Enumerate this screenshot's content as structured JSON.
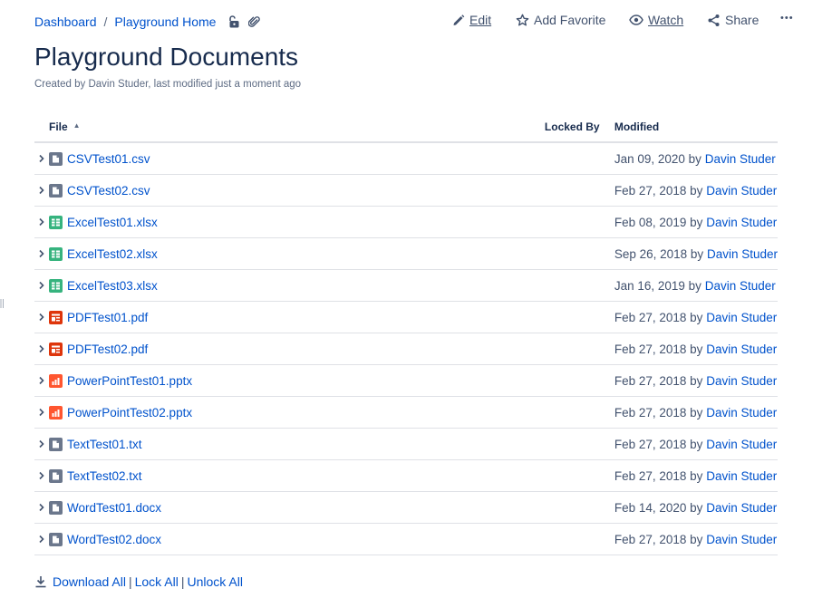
{
  "breadcrumb": {
    "items": [
      {
        "label": "Dashboard"
      },
      {
        "label": "Playground Home"
      }
    ],
    "separator": "/"
  },
  "actions": {
    "edit": "Edit",
    "add_favorite": "Add Favorite",
    "watch": "Watch",
    "share": "Share",
    "more": "•••"
  },
  "page": {
    "title": "Playground Documents",
    "byline_prefix": "Created by Davin Studer, last modified ",
    "byline_time": "just a moment ago"
  },
  "table": {
    "headers": {
      "file": "File",
      "locked_by": "Locked By",
      "modified": "Modified"
    },
    "rows": [
      {
        "name": "CSVTest01.csv",
        "type": "generic",
        "date": "Jan 09, 2020",
        "by": "by",
        "user": "Davin Studer"
      },
      {
        "name": "CSVTest02.csv",
        "type": "generic",
        "date": "Feb 27, 2018",
        "by": "by",
        "user": "Davin Studer"
      },
      {
        "name": "ExcelTest01.xlsx",
        "type": "excel",
        "date": "Feb 08, 2019",
        "by": "by",
        "user": "Davin Studer"
      },
      {
        "name": "ExcelTest02.xlsx",
        "type": "excel",
        "date": "Sep 26, 2018",
        "by": "by",
        "user": "Davin Studer"
      },
      {
        "name": "ExcelTest03.xlsx",
        "type": "excel",
        "date": "Jan 16, 2019",
        "by": "by",
        "user": "Davin Studer"
      },
      {
        "name": "PDFTest01.pdf",
        "type": "pdf",
        "date": "Feb 27, 2018",
        "by": "by",
        "user": "Davin Studer"
      },
      {
        "name": "PDFTest02.pdf",
        "type": "pdf",
        "date": "Feb 27, 2018",
        "by": "by",
        "user": "Davin Studer"
      },
      {
        "name": "PowerPointTest01.pptx",
        "type": "ppt",
        "date": "Feb 27, 2018",
        "by": "by",
        "user": "Davin Studer"
      },
      {
        "name": "PowerPointTest02.pptx",
        "type": "ppt",
        "date": "Feb 27, 2018",
        "by": "by",
        "user": "Davin Studer"
      },
      {
        "name": "TextTest01.txt",
        "type": "generic",
        "date": "Feb 27, 2018",
        "by": "by",
        "user": "Davin Studer"
      },
      {
        "name": "TextTest02.txt",
        "type": "generic",
        "date": "Feb 27, 2018",
        "by": "by",
        "user": "Davin Studer"
      },
      {
        "name": "WordTest01.docx",
        "type": "generic",
        "date": "Feb 14, 2020",
        "by": "by",
        "user": "Davin Studer"
      },
      {
        "name": "WordTest02.docx",
        "type": "generic",
        "date": "Feb 27, 2018",
        "by": "by",
        "user": "Davin Studer"
      }
    ]
  },
  "footer": {
    "download_all": "Download All",
    "lock_all": "Lock All",
    "unlock_all": "Unlock All",
    "separator": "|"
  },
  "colors": {
    "link": "#0052cc",
    "generic": "#6b778c",
    "excel": "#36b37e",
    "pdf": "#de350b",
    "ppt": "#ff5630"
  }
}
